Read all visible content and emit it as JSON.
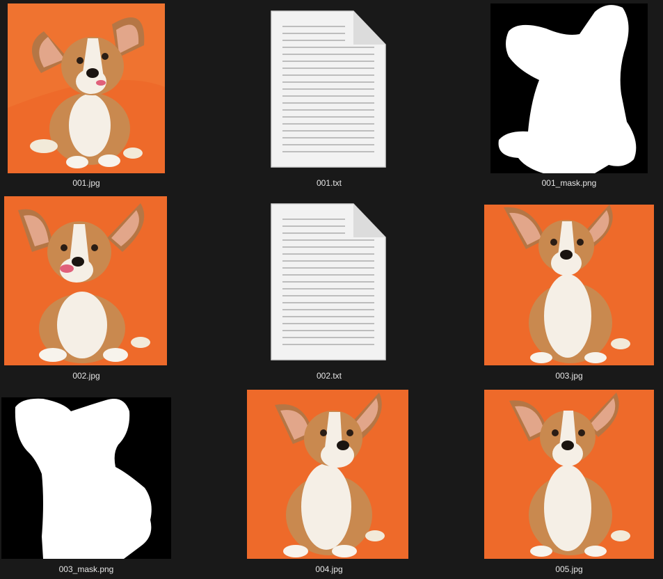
{
  "files": [
    {
      "name": "001.jpg",
      "kind": "photo",
      "pose": "tongue-right"
    },
    {
      "name": "001.txt",
      "kind": "text-document",
      "icon": "text-file-icon"
    },
    {
      "name": "001_mask.png",
      "kind": "mask",
      "shape": "crouching"
    },
    {
      "name": "002.jpg",
      "kind": "photo",
      "pose": "tongue-left"
    },
    {
      "name": "002.txt",
      "kind": "text-document",
      "icon": "text-file-icon"
    },
    {
      "name": "003.jpg",
      "kind": "photo",
      "pose": "sitting-front"
    },
    {
      "name": "003_mask.png",
      "kind": "mask",
      "shape": "sitting-tall"
    },
    {
      "name": "004.jpg",
      "kind": "photo",
      "pose": "sitting-smile"
    },
    {
      "name": "005.jpg",
      "kind": "photo",
      "pose": "sitting-front"
    }
  ],
  "colors": {
    "background": "#191919",
    "photo_background": "#ee6a2a",
    "label_text": "#e6e6e6",
    "mask_background": "#000000",
    "mask_foreground": "#ffffff"
  }
}
